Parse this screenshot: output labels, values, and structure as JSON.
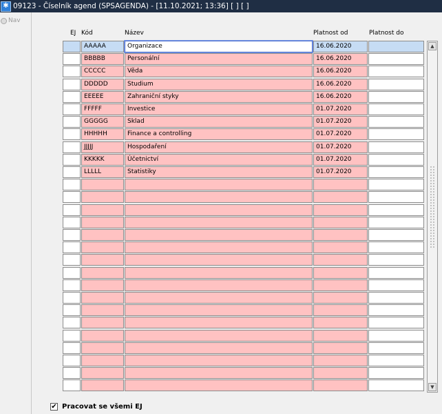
{
  "window": {
    "title": "09123 - Číselník agend (SPSAGENDA) - [11.10.2021; 13:36]  [ ]  [ ]"
  },
  "nav": {
    "label": "Nav"
  },
  "columns": {
    "ej": "EJ",
    "kod": "Kód",
    "nazev": "Název",
    "platnost_od": "Platnost od",
    "platnost_do": "Platnost do"
  },
  "rows": [
    {
      "ej": "",
      "kod": "AAAAA",
      "nazev": "Organizace",
      "od": "16.06.2020",
      "do": ""
    },
    {
      "ej": "",
      "kod": "BBBBB",
      "nazev": "Personální",
      "od": "16.06.2020",
      "do": ""
    },
    {
      "ej": "",
      "kod": "CCCCC",
      "nazev": "Věda",
      "od": "16.06.2020",
      "do": ""
    },
    {
      "ej": "",
      "kod": "DDDDD",
      "nazev": "Studium",
      "od": "16.06.2020",
      "do": ""
    },
    {
      "ej": "",
      "kod": "EEEEE",
      "nazev": "Zahraniční styky",
      "od": "16.06.2020",
      "do": ""
    },
    {
      "ej": "",
      "kod": "FFFFF",
      "nazev": "Investice",
      "od": "01.07.2020",
      "do": ""
    },
    {
      "ej": "",
      "kod": "GGGGG",
      "nazev": "Sklad",
      "od": "01.07.2020",
      "do": ""
    },
    {
      "ej": "",
      "kod": "HHHHH",
      "nazev": "Finance a controlling",
      "od": "01.07.2020",
      "do": ""
    },
    {
      "ej": "",
      "kod": "JJJJJ",
      "nazev": "Hospodaření",
      "od": "01.07.2020",
      "do": ""
    },
    {
      "ej": "",
      "kod": "KKKKK",
      "nazev": "Účetnictví",
      "od": "01.07.2020",
      "do": ""
    },
    {
      "ej": "",
      "kod": "LLLLL",
      "nazev": "Statistiky",
      "od": "01.07.2020",
      "do": ""
    },
    {
      "ej": "",
      "kod": "",
      "nazev": "",
      "od": "",
      "do": ""
    },
    {
      "ej": "",
      "kod": "",
      "nazev": "",
      "od": "",
      "do": ""
    },
    {
      "ej": "",
      "kod": "",
      "nazev": "",
      "od": "",
      "do": ""
    },
    {
      "ej": "",
      "kod": "",
      "nazev": "",
      "od": "",
      "do": ""
    },
    {
      "ej": "",
      "kod": "",
      "nazev": "",
      "od": "",
      "do": ""
    },
    {
      "ej": "",
      "kod": "",
      "nazev": "",
      "od": "",
      "do": ""
    },
    {
      "ej": "",
      "kod": "",
      "nazev": "",
      "od": "",
      "do": ""
    },
    {
      "ej": "",
      "kod": "",
      "nazev": "",
      "od": "",
      "do": ""
    },
    {
      "ej": "",
      "kod": "",
      "nazev": "",
      "od": "",
      "do": ""
    },
    {
      "ej": "",
      "kod": "",
      "nazev": "",
      "od": "",
      "do": ""
    },
    {
      "ej": "",
      "kod": "",
      "nazev": "",
      "od": "",
      "do": ""
    },
    {
      "ej": "",
      "kod": "",
      "nazev": "",
      "od": "",
      "do": ""
    },
    {
      "ej": "",
      "kod": "",
      "nazev": "",
      "od": "",
      "do": ""
    },
    {
      "ej": "",
      "kod": "",
      "nazev": "",
      "od": "",
      "do": ""
    },
    {
      "ej": "",
      "kod": "",
      "nazev": "",
      "od": "",
      "do": ""
    },
    {
      "ej": "",
      "kod": "",
      "nazev": "",
      "od": "",
      "do": ""
    },
    {
      "ej": "",
      "kod": "",
      "nazev": "",
      "od": "",
      "do": ""
    }
  ],
  "scrollbar": {
    "up_icon": "arrow-up-icon",
    "down_icon": "arrow-down-icon"
  },
  "footer": {
    "checkbox_label": "Pracovat se všemi EJ",
    "checked": true
  },
  "colors": {
    "titlebar": "#1f2e44",
    "row_pink": "#ffc2c2",
    "row_selected": "#c6dcf4"
  }
}
